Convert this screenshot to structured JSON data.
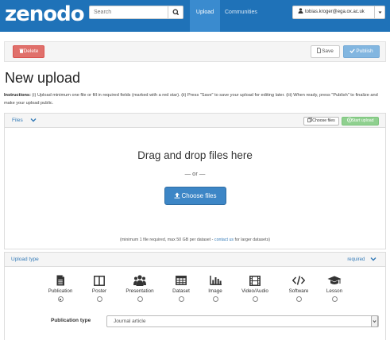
{
  "navbar": {
    "logo": "zenodo",
    "search_placeholder": "Search",
    "upload_label": "Upload",
    "communities_label": "Communities",
    "user_email": "tobias.kroger@ega.ox.ac.uk"
  },
  "actions": {
    "delete_label": "Delete",
    "save_label": "Save",
    "publish_label": "Publish"
  },
  "page": {
    "title": "New upload",
    "instructions_label": "Instructions:",
    "instructions_text": " (i) Upload minimum one file or fill in required fields (marked with a red star). (ii) Press \"Save\" to save your upload for editing later. (iii) When ready, press \"Publish\" to finalize and make your upload public."
  },
  "files": {
    "header_label": "Files",
    "choose_small_label": "Choose files",
    "start_upload_label": "Start upload",
    "drop_title": "Drag and drop files here",
    "or_text": "— or —",
    "choose_big_label": "Choose files",
    "limits_text": "(minimum 1 file required, max 50 GB per dataset - ",
    "limits_link": "contact us",
    "limits_tail": " for larger datasets)"
  },
  "upload_type": {
    "header_label": "Upload type",
    "required_label": "required",
    "options": [
      {
        "label": "Publication",
        "icon": "book-icon",
        "checked": true
      },
      {
        "label": "Poster",
        "icon": "columns-icon",
        "checked": false
      },
      {
        "label": "Presentation",
        "icon": "group-icon",
        "checked": false
      },
      {
        "label": "Dataset",
        "icon": "table-icon",
        "checked": false
      },
      {
        "label": "Image",
        "icon": "bar-chart-icon",
        "checked": false
      },
      {
        "label": "Video/Audio",
        "icon": "film-icon",
        "checked": false
      },
      {
        "label": "Software",
        "icon": "code-icon",
        "checked": false
      },
      {
        "label": "Lesson",
        "icon": "graduation-cap-icon",
        "checked": false
      }
    ]
  },
  "publication_type": {
    "label": "Publication type",
    "selected": "Journal article"
  },
  "colors": {
    "navbar": "#1f72b8",
    "delete": "#e0706b",
    "publish": "#82b6e0",
    "primary": "#3d86c6",
    "start_upload": "#8fd08f",
    "link": "#337ab7"
  }
}
